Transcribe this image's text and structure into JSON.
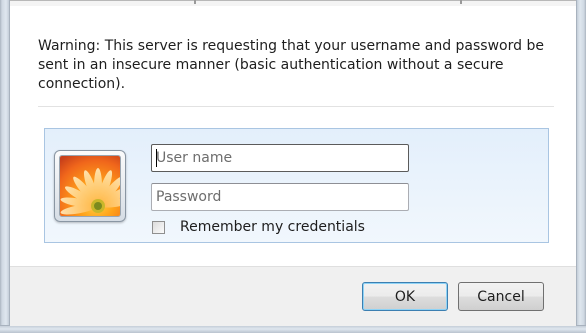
{
  "dialog": {
    "warning": "Warning: This server is requesting that your username and password be sent in an insecure manner (basic authentication without a secure connection).",
    "username_placeholder": "User name",
    "password_placeholder": "Password",
    "remember_label": "Remember my credentials",
    "remember_checked": false,
    "ok_label": "OK",
    "cancel_label": "Cancel",
    "tile_icon": "flower-icon"
  },
  "colors": {
    "panel_border": "#a9c5e2",
    "panel_bg": "#e3effb",
    "footer_bg": "#f0f0f0",
    "ok_focus_border": "#3c7fb1"
  }
}
